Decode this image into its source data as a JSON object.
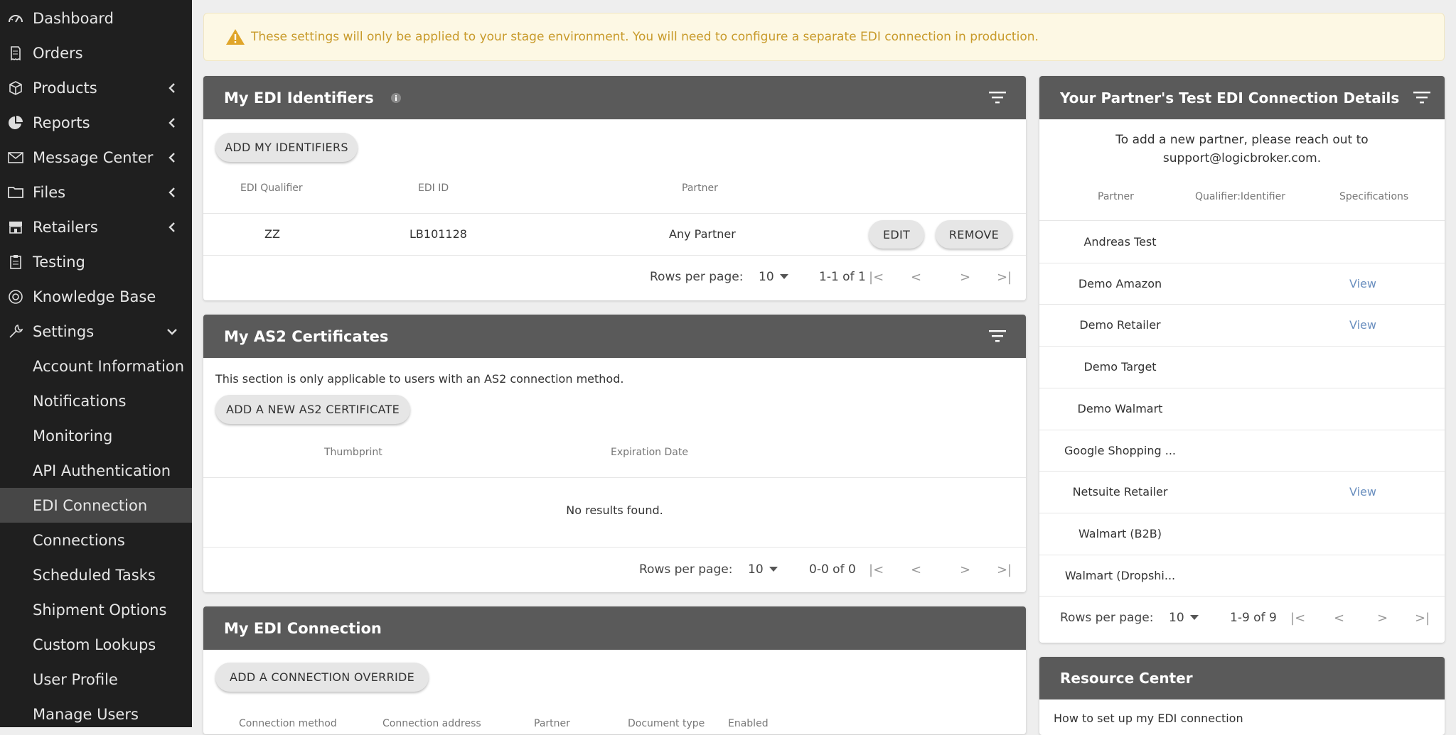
{
  "sidebar": {
    "items": [
      {
        "label": "Dashboard",
        "icon": "gauge-icon",
        "chevron": ""
      },
      {
        "label": "Orders",
        "icon": "receipt-icon",
        "chevron": ""
      },
      {
        "label": "Products",
        "icon": "box-icon",
        "chevron": "left"
      },
      {
        "label": "Reports",
        "icon": "pie-chart-icon",
        "chevron": "left"
      },
      {
        "label": "Message Center",
        "icon": "envelope-icon",
        "chevron": "left"
      },
      {
        "label": "Files",
        "icon": "folder-icon",
        "chevron": "left"
      },
      {
        "label": "Retailers",
        "icon": "store-icon",
        "chevron": "left"
      },
      {
        "label": "Testing",
        "icon": "clipboard-icon",
        "chevron": ""
      },
      {
        "label": "Knowledge Base",
        "icon": "lifebuoy-icon",
        "chevron": ""
      },
      {
        "label": "Settings",
        "icon": "tools-icon",
        "chevron": "down"
      }
    ],
    "sub_items": [
      "Account Information",
      "Notifications",
      "Monitoring",
      "API Authentication",
      "EDI Connection",
      "Connections",
      "Scheduled Tasks",
      "Shipment Options",
      "Custom Lookups",
      "User Profile",
      "Manage Users"
    ],
    "active_sub": "EDI Connection"
  },
  "banner": {
    "text": "These settings will only be applied to your stage environment. You will need to configure a separate EDI connection in production."
  },
  "identifiers": {
    "title": "My EDI Identifiers",
    "add_button": "ADD MY IDENTIFIERS",
    "columns": [
      "EDI Qualifier",
      "EDI ID",
      "Partner"
    ],
    "rows": [
      {
        "qualifier": "ZZ",
        "id": "LB101128",
        "partner": "Any Partner"
      }
    ],
    "edit_button": "EDIT",
    "remove_button": "REMOVE",
    "rows_per_page_label": "Rows per page:",
    "rows_per_page": "10",
    "range": "1-1 of 1"
  },
  "as2": {
    "title": "My AS2 Certificates",
    "note": "This section is only applicable to users with an AS2 connection method.",
    "add_button": "ADD A NEW AS2 CERTIFICATE",
    "columns": [
      "Thumbprint",
      "Expiration Date"
    ],
    "empty": "No results found.",
    "rows_per_page_label": "Rows per page:",
    "rows_per_page": "10",
    "range": "0-0 of 0"
  },
  "connection": {
    "title": "My EDI Connection",
    "add_button": "ADD A CONNECTION OVERRIDE",
    "columns": [
      "Connection method",
      "Connection address",
      "Partner",
      "Document type",
      "Enabled"
    ]
  },
  "partners": {
    "title": "Your Partner's Test EDI Connection Details",
    "note_line1": "To add a new partner, please reach out to",
    "note_line2": "support@logicbroker.com.",
    "columns": [
      "Partner",
      "Qualifier:Identifier",
      "Specifications"
    ],
    "rows": [
      {
        "partner": "Andreas Test",
        "spec": ""
      },
      {
        "partner": "Demo Amazon",
        "spec": "View"
      },
      {
        "partner": "Demo Retailer",
        "spec": "View"
      },
      {
        "partner": "Demo Target",
        "spec": ""
      },
      {
        "partner": "Demo Walmart",
        "spec": ""
      },
      {
        "partner": "Google Shopping ...",
        "spec": ""
      },
      {
        "partner": "Netsuite Retailer",
        "spec": "View"
      },
      {
        "partner": "Walmart (B2B)",
        "spec": ""
      },
      {
        "partner": "Walmart (Dropshi...",
        "spec": ""
      }
    ],
    "rows_per_page_label": "Rows per page:",
    "rows_per_page": "10",
    "range": "1-9 of 9"
  },
  "resource": {
    "title": "Resource Center",
    "link": "How to set up my EDI connection"
  },
  "colors": {
    "sidebar": "#1f1f1f",
    "header": "#5a5a5a",
    "banner_text": "#c89a2a",
    "link": "#6a8fbf"
  }
}
